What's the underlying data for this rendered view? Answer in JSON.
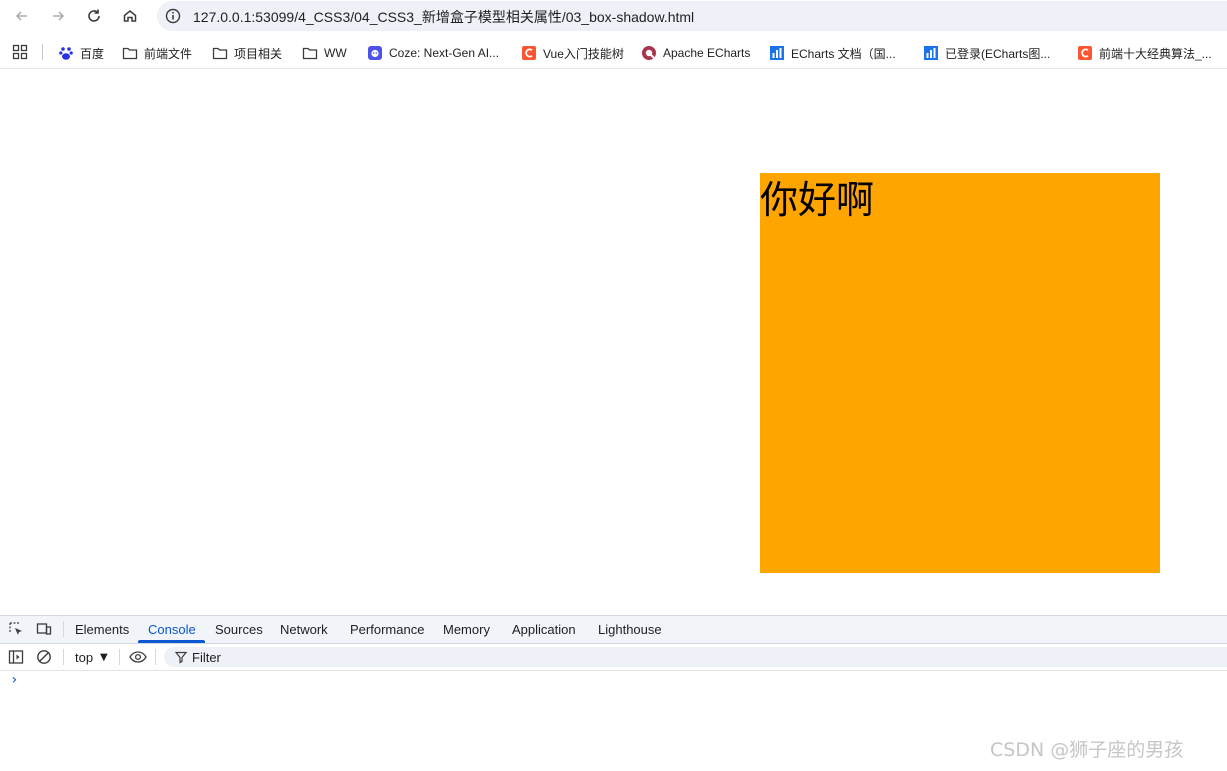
{
  "browser": {
    "url": "127.0.0.1:53099/4_CSS3/04_CSS3_新增盒子模型相关属性/03_box-shadow.html",
    "bookmarks": [
      {
        "label": "百度",
        "icon": "baidu-icon"
      },
      {
        "label": "前端文件",
        "icon": "folder-icon"
      },
      {
        "label": "项目相关",
        "icon": "folder-icon"
      },
      {
        "label": "WW",
        "icon": "folder-icon"
      },
      {
        "label": "Coze: Next-Gen AI...",
        "icon": "coze-icon"
      },
      {
        "label": "Vue入门技能树",
        "icon": "csdn-icon"
      },
      {
        "label": "Apache ECharts",
        "icon": "echarts-icon"
      },
      {
        "label": "ECharts 文档（国...",
        "icon": "chart-icon"
      },
      {
        "label": "已登录(ECharts图...",
        "icon": "chart-icon"
      },
      {
        "label": "前端十大经典算法_...",
        "icon": "csdn-icon"
      }
    ]
  },
  "page": {
    "box_text": "你好啊",
    "box_color": "#ffa500"
  },
  "devtools": {
    "tabs": [
      "Elements",
      "Console",
      "Sources",
      "Network",
      "Performance",
      "Memory",
      "Application",
      "Lighthouse"
    ],
    "active_tab": "Console",
    "context": "top",
    "filter_placeholder": "Filter",
    "prompt": "›"
  },
  "watermark": "CSDN @狮子座的男孩"
}
